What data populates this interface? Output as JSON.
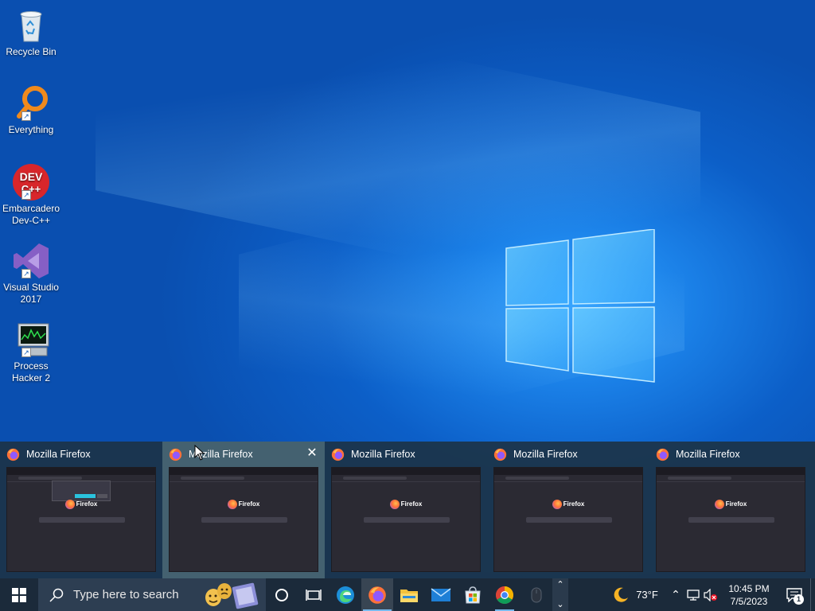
{
  "desktop": {
    "icons": [
      {
        "label": "Recycle Bin",
        "icon": "recycle-bin-icon"
      },
      {
        "label": "Everything",
        "icon": "everything-search-icon"
      },
      {
        "label": "Embarcadero Dev-C++",
        "icon": "devcpp-icon",
        "glyph": "DEV C++"
      },
      {
        "label": "Visual Studio 2017",
        "icon": "visual-studio-icon"
      },
      {
        "label": "Process Hacker 2",
        "icon": "process-hacker-icon"
      }
    ]
  },
  "thumbnails": [
    {
      "title": "Mozilla Firefox",
      "preview_brand": "Firefox",
      "has_dialog": true
    },
    {
      "title": "Mozilla Firefox",
      "preview_brand": "Firefox",
      "hovered": true,
      "close_glyph": "✕"
    },
    {
      "title": "Mozilla Firefox",
      "preview_brand": "Firefox"
    },
    {
      "title": "Mozilla Firefox",
      "preview_brand": "Firefox"
    },
    {
      "title": "Mozilla Firefox",
      "preview_brand": "Firefox"
    }
  ],
  "taskbar": {
    "search_placeholder": "Type here to search",
    "apps": [
      {
        "name": "cortana-icon"
      },
      {
        "name": "task-view-icon"
      },
      {
        "name": "edge-icon"
      },
      {
        "name": "firefox-icon",
        "active": true
      },
      {
        "name": "file-explorer-icon"
      },
      {
        "name": "mail-icon"
      },
      {
        "name": "microsoft-store-icon"
      },
      {
        "name": "chrome-icon"
      },
      {
        "name": "mouse-app-icon"
      }
    ],
    "weather": {
      "temp": "73°F",
      "icon": "moon-icon"
    },
    "clock": {
      "time": "10:45 PM",
      "date": "7/5/2023"
    },
    "notification_count": "1"
  },
  "colors": {
    "desktop_blue": "#0c5fc8",
    "taskbar": "#1b2a3a",
    "thumb_strip": "#1c3448",
    "accent": "#76b9ed"
  }
}
